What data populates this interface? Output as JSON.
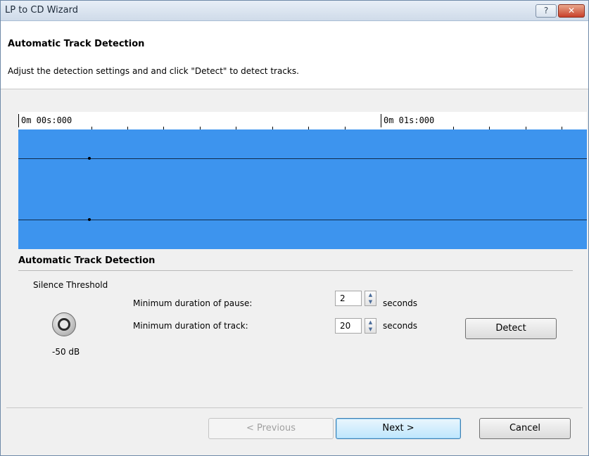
{
  "window": {
    "title": "LP to CD Wizard",
    "help_glyph": "?",
    "close_glyph": "✕"
  },
  "header": {
    "title": "Automatic Track Detection",
    "description": "Adjust the detection settings and and click \"Detect\" to detect tracks."
  },
  "timeline": {
    "start_label": "0m 00s:000",
    "mid_label": "0m 01s:000"
  },
  "detection": {
    "section_title": "Automatic Track Detection",
    "silence_threshold_label": "Silence Threshold",
    "silence_threshold_value": "-50 dB",
    "min_pause_label": "Minimum duration of pause:",
    "min_pause_value": "2",
    "min_track_label": "Minimum duration of track:",
    "min_track_value": "20",
    "unit_label": "seconds",
    "detect_button": "Detect"
  },
  "footer": {
    "previous_button": "< Previous",
    "next_button": "Next >",
    "cancel_button": "Cancel"
  },
  "colors": {
    "waveform": "#3d94ee",
    "primary_button": "#bee6fd"
  }
}
